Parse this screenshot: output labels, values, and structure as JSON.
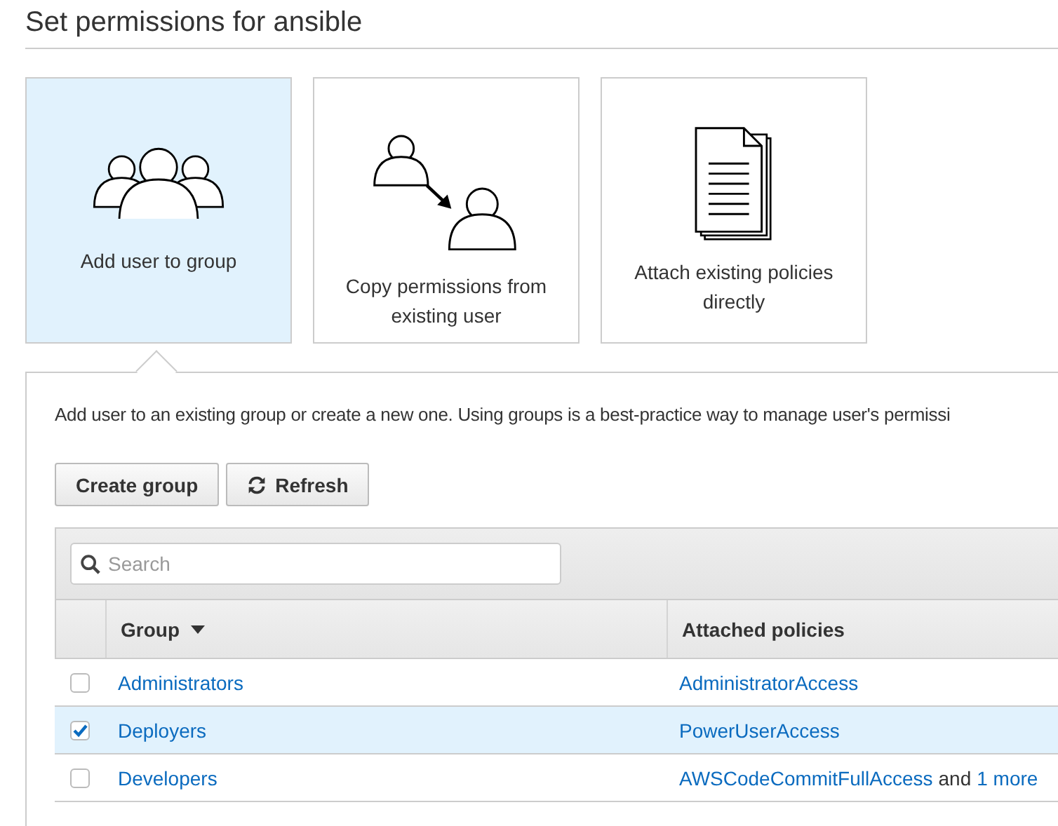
{
  "title": "Set permissions for ansible",
  "options": [
    {
      "kind": "group",
      "label": "Add user to group",
      "selected": true
    },
    {
      "kind": "copy",
      "label": "Copy permissions from existing user",
      "selected": false
    },
    {
      "kind": "attach",
      "label": "Attach existing policies directly",
      "selected": false
    }
  ],
  "description": "Add user to an existing group or create a new one. Using groups is a best-practice way to manage user's permissi",
  "buttons": [
    {
      "kind": "plain",
      "label": "Create group"
    },
    {
      "kind": "refresh",
      "label": "Refresh"
    }
  ],
  "search": {
    "placeholder": "Search"
  },
  "table": {
    "columns": [
      {
        "label": "Group",
        "sorted": true
      },
      {
        "label": "Attached policies",
        "sorted": false
      }
    ],
    "rows": [
      {
        "group": "Administrators",
        "checked": false,
        "selected": false,
        "policies": [
          {
            "kind": "link",
            "text": "AdministratorAccess"
          }
        ]
      },
      {
        "group": "Deployers",
        "checked": true,
        "selected": true,
        "policies": [
          {
            "kind": "link",
            "text": "PowerUserAccess"
          }
        ]
      },
      {
        "group": "Developers",
        "checked": false,
        "selected": false,
        "policies": [
          {
            "kind": "link",
            "text": "AWSCodeCommitFullAccess"
          },
          {
            "kind": "text",
            "text": "and"
          },
          {
            "kind": "link",
            "text": "1 more"
          }
        ]
      }
    ]
  }
}
